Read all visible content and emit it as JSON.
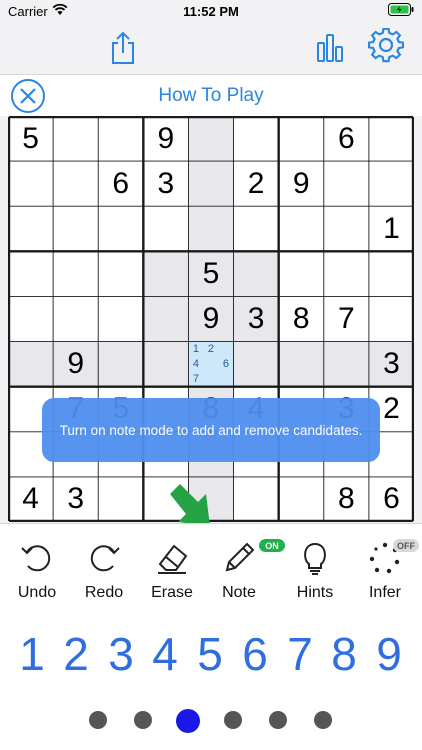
{
  "status_bar": {
    "carrier": "Carrier",
    "time": "11:52 PM"
  },
  "header": {
    "share_icon": "share-icon",
    "stats_icon": "bar-chart-icon",
    "settings_icon": "gear-icon",
    "accent_color": "#2a86e0"
  },
  "howto": {
    "title": "How To Play",
    "close_icon": "close-circle-icon"
  },
  "board": {
    "givens": [
      [
        5,
        0,
        0,
        9,
        0,
        0,
        0,
        6,
        0
      ],
      [
        0,
        0,
        6,
        3,
        0,
        2,
        9,
        0,
        0
      ],
      [
        0,
        0,
        0,
        0,
        0,
        0,
        0,
        0,
        1
      ],
      [
        0,
        0,
        0,
        0,
        5,
        0,
        0,
        0,
        0
      ],
      [
        0,
        0,
        0,
        0,
        9,
        3,
        8,
        7,
        0
      ],
      [
        0,
        9,
        0,
        0,
        0,
        0,
        0,
        0,
        3
      ],
      [
        0,
        7,
        5,
        0,
        8,
        4,
        0,
        3,
        2
      ],
      [
        0,
        0,
        0,
        0,
        0,
        0,
        0,
        0,
        0
      ],
      [
        4,
        3,
        0,
        0,
        0,
        0,
        0,
        8,
        6
      ]
    ],
    "selected_cell": {
      "row": 5,
      "col": 4
    },
    "selected_notes": [
      "1",
      "2",
      "",
      "4",
      "",
      "6",
      "7",
      "",
      ""
    ]
  },
  "tooltip": {
    "text": "Turn on note mode to add and remove candidates."
  },
  "toolbar": {
    "undo": "Undo",
    "redo": "Redo",
    "erase": "Erase",
    "note": "Note",
    "hints": "Hints",
    "infer": "Infer",
    "note_badge": "ON",
    "infer_badge": "OFF"
  },
  "numpad": [
    "1",
    "2",
    "3",
    "4",
    "5",
    "6",
    "7",
    "8",
    "9"
  ],
  "pager": {
    "count": 6,
    "active": 2
  }
}
